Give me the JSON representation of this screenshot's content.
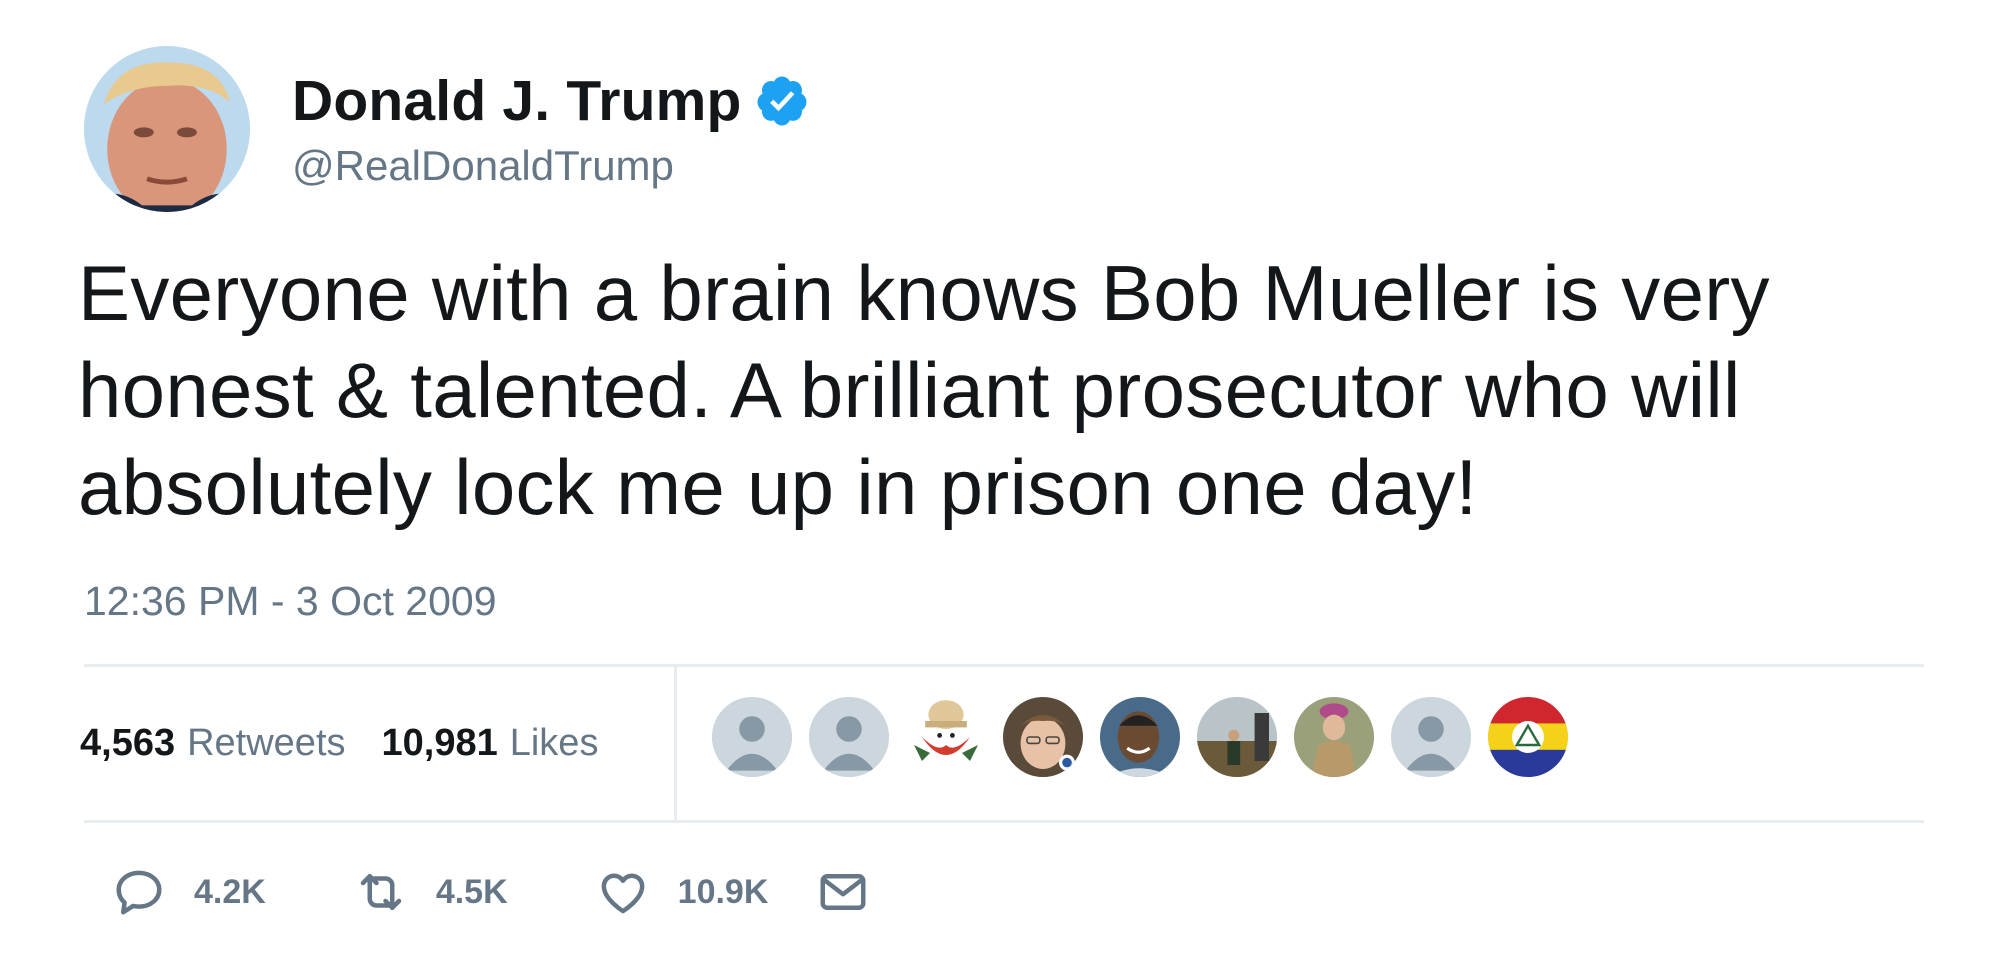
{
  "author": {
    "display_name": "Donald J. Trump",
    "handle": "@RealDonaldTrump",
    "verified_icon": "verified-badge-icon"
  },
  "tweet": {
    "text": "Everyone with a brain knows Bob Mueller is very honest & talented. A brilliant prosecutor who will absolutely lock me up in prison one day!",
    "timestamp": "12:36 PM - 3 Oct 2009"
  },
  "stats": {
    "retweets_count": "4,563",
    "retweets_label": "Retweets",
    "likes_count": "10,981",
    "likes_label": "Likes"
  },
  "actions": {
    "reply_count": "4.2K",
    "retweet_count": "4.5K",
    "like_count": "10.9K"
  },
  "colors": {
    "text": "#14171a",
    "secondary": "#657786",
    "verified": "#1da1f2",
    "divider": "#e6ecf0"
  }
}
